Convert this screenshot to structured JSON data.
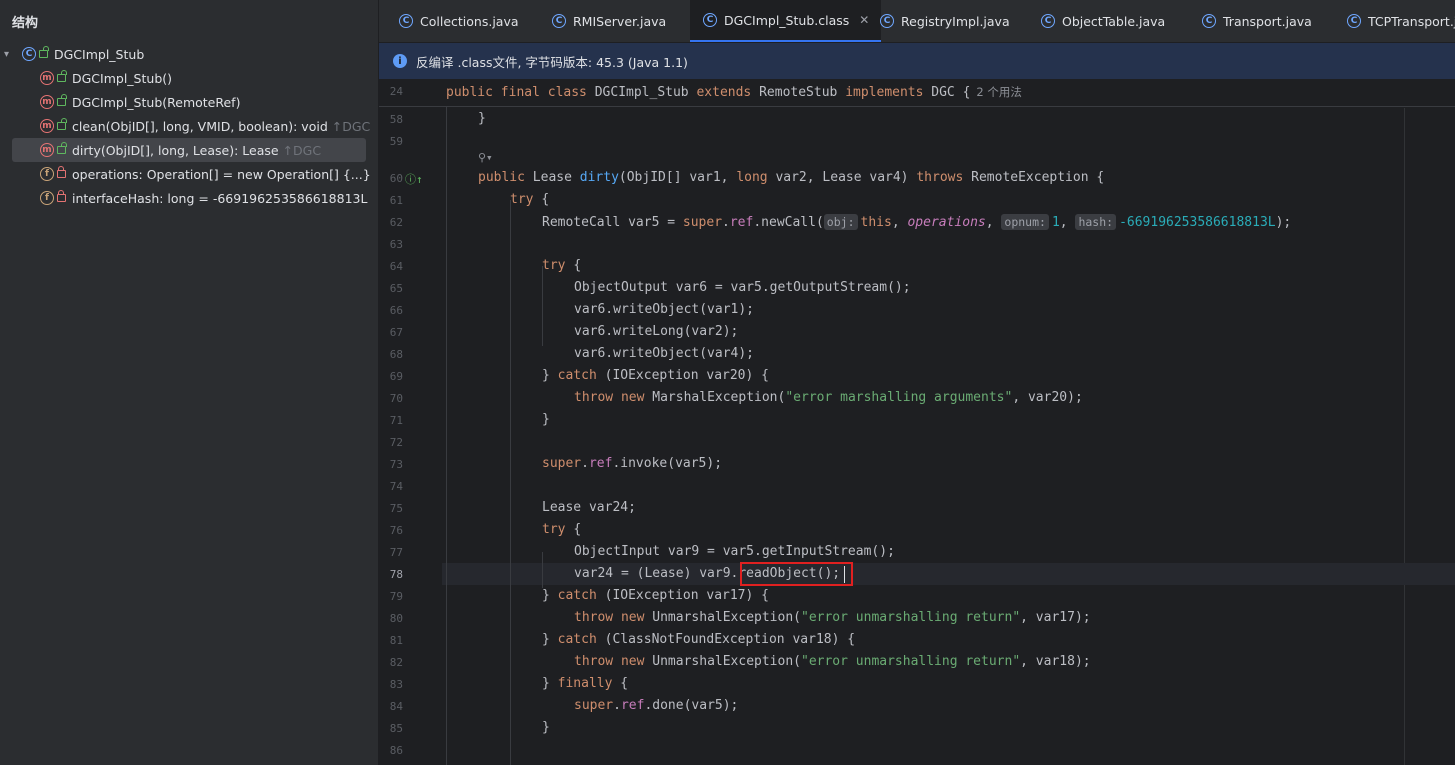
{
  "structure": {
    "title": "结构",
    "root": "DGCImpl_Stub",
    "members": [
      {
        "label": "DGCImpl_Stub()",
        "suffix": ""
      },
      {
        "label": "DGCImpl_Stub(RemoteRef)",
        "suffix": ""
      },
      {
        "label": "clean(ObjID[], long, VMID, boolean): void",
        "suffix": "↑DGC"
      },
      {
        "label": "dirty(ObjID[], long, Lease): Lease",
        "suffix": "↑DGC"
      },
      {
        "label": "operations: Operation[] = new Operation[] {...}",
        "suffix": ""
      },
      {
        "label": "interfaceHash: long = -669196253586618813L",
        "suffix": ""
      }
    ]
  },
  "tabs": [
    {
      "label": "Collections.java"
    },
    {
      "label": "RMIServer.java"
    },
    {
      "label": "DGCImpl_Stub.class",
      "active": true
    },
    {
      "label": "RegistryImpl.java"
    },
    {
      "label": "ObjectTable.java"
    },
    {
      "label": "Transport.java"
    },
    {
      "label": "TCPTransport.java"
    }
  ],
  "banner": {
    "text": "反编译 .class文件, 字节码版本: 45.3 (Java 1.1)"
  },
  "editor": {
    "sticky_line": "24",
    "usage_hint": "2 个用法",
    "line_numbers": [
      "58",
      "59",
      "60",
      "61",
      "62",
      "63",
      "64",
      "65",
      "66",
      "67",
      "68",
      "69",
      "70",
      "71",
      "72",
      "73",
      "74",
      "75",
      "76",
      "77",
      "78",
      "79",
      "80",
      "81",
      "82",
      "83",
      "84",
      "85",
      "86"
    ],
    "hints": {
      "obj": "obj:",
      "opnum": "opnum:",
      "hash": "hash:"
    }
  },
  "colors": {
    "accent": "#3574f0",
    "highlight_box": "#e02020",
    "banner_bg": "#25324d"
  }
}
